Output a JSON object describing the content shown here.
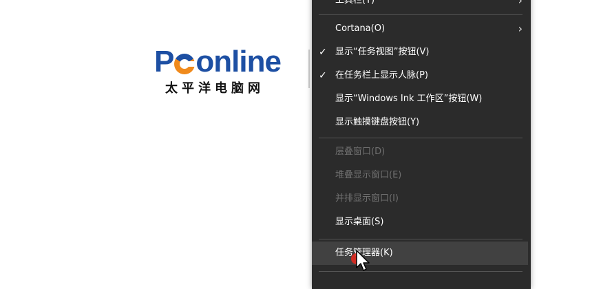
{
  "logo": {
    "brand_p": "P",
    "brand_rest": "online",
    "subtitle": "太平洋电脑网",
    "colors": {
      "blue": "#1d4fa3",
      "orange": "#f08a1c"
    }
  },
  "context_menu": {
    "top_partial_label": "工具栏(T)",
    "items": [
      {
        "label": "Cortana(O)",
        "checked": false,
        "submenu": true,
        "enabled": true
      },
      {
        "label": "显示“任务视图”按钮(V)",
        "checked": true,
        "submenu": false,
        "enabled": true
      },
      {
        "label": "在任务栏上显示人脉(P)",
        "checked": true,
        "submenu": false,
        "enabled": true
      },
      {
        "label": "显示“Windows Ink 工作区”按钮(W)",
        "checked": false,
        "submenu": false,
        "enabled": true
      },
      {
        "label": "显示触摸键盘按钮(Y)",
        "checked": false,
        "submenu": false,
        "enabled": true
      },
      {
        "label": "层叠窗口(D)",
        "checked": false,
        "submenu": false,
        "enabled": false
      },
      {
        "label": "堆叠显示窗口(E)",
        "checked": false,
        "submenu": false,
        "enabled": false
      },
      {
        "label": "并排显示窗口(I)",
        "checked": false,
        "submenu": false,
        "enabled": false
      },
      {
        "label": "显示桌面(S)",
        "checked": false,
        "submenu": false,
        "enabled": true
      },
      {
        "label": "任务管理器(K)",
        "checked": false,
        "submenu": false,
        "enabled": true,
        "hovered": true
      }
    ],
    "check_glyph": "✓",
    "chevron_glyph": "›",
    "colors": {
      "background": "#2b2b2b",
      "text": "#ffffff",
      "disabled_text": "#6f6f6f",
      "hover": "#414141",
      "divider": "#555555"
    }
  },
  "cursor": {
    "icon": "arrow-pointer-icon",
    "highlight_color": "#e0291f"
  }
}
